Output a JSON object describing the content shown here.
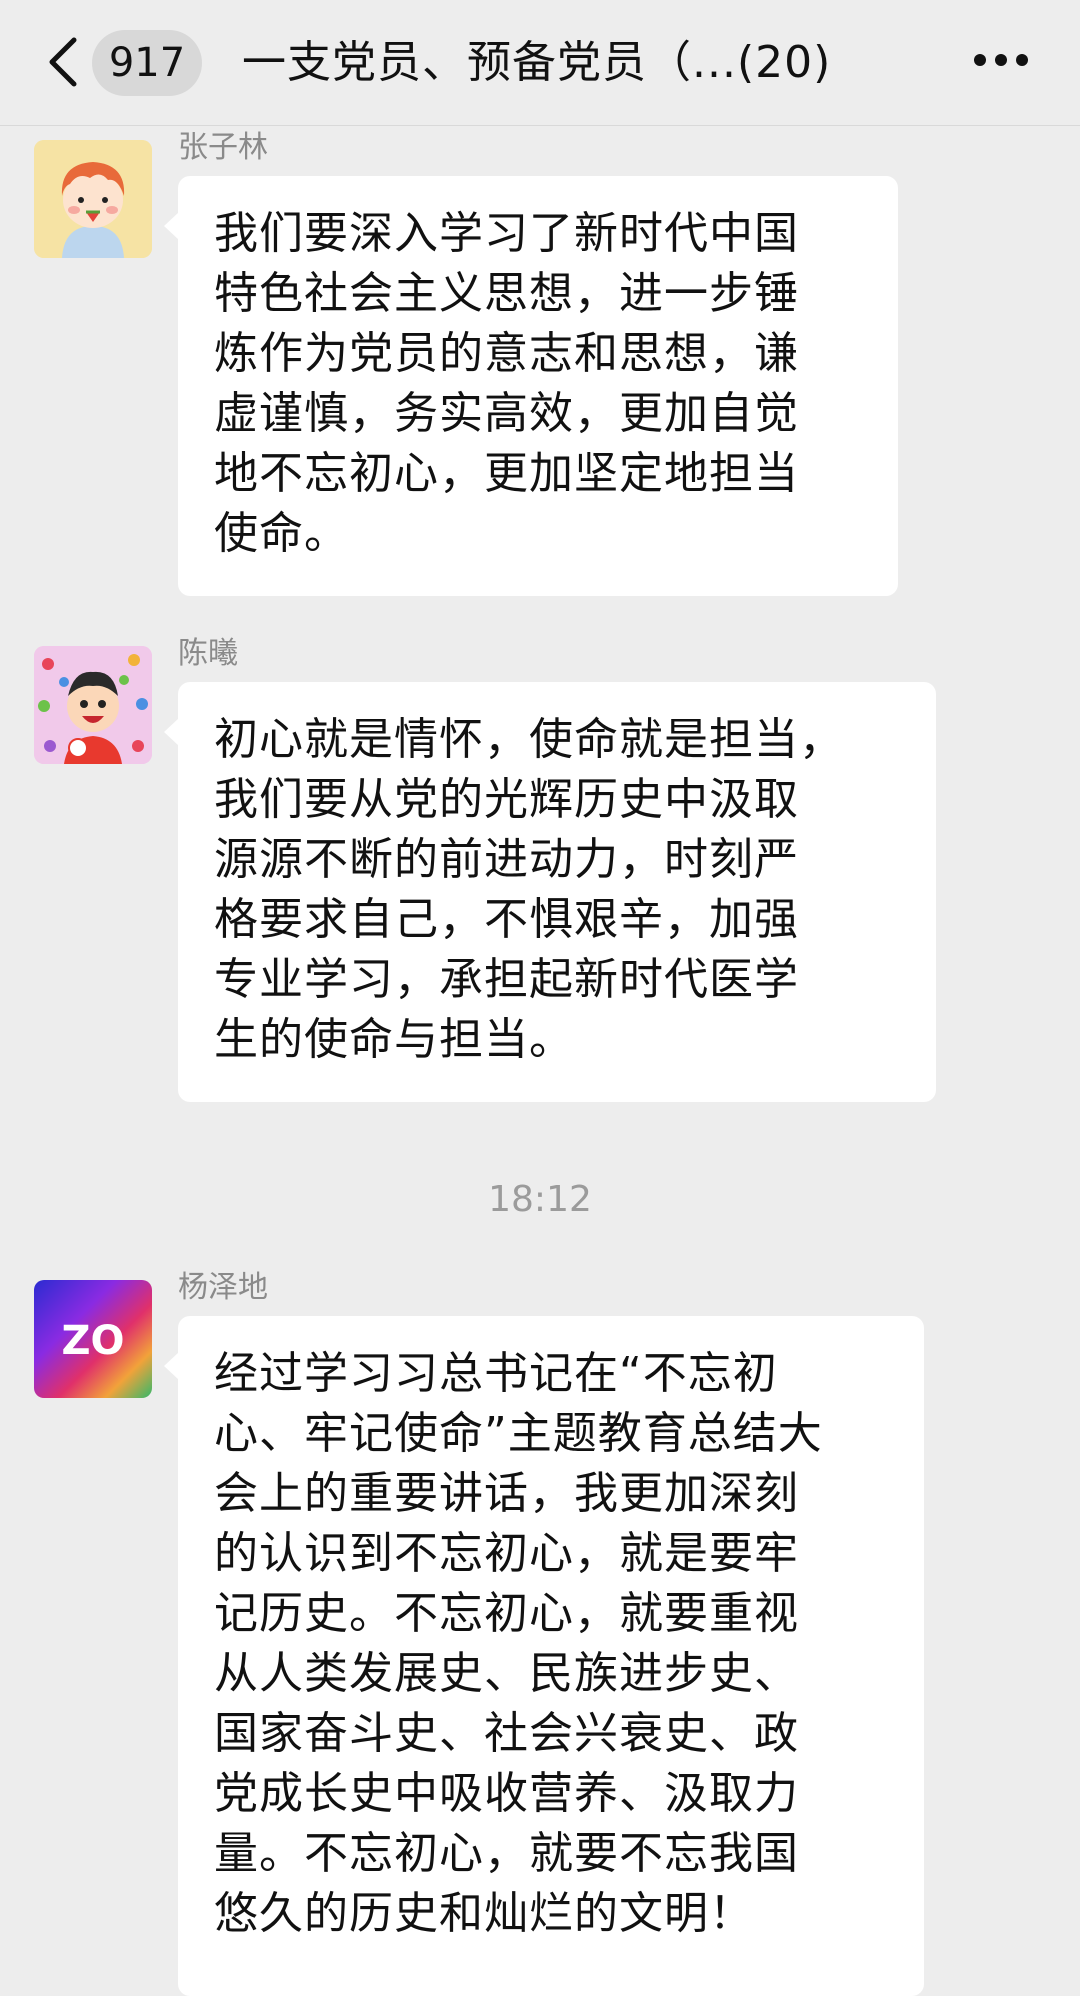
{
  "header": {
    "unread_count": "917",
    "title": "一支党员、预备党员（...(20)",
    "back_icon": "chevron-left-icon",
    "more_icon": "ellipsis-icon"
  },
  "messages": [
    {
      "sender": "张子林",
      "text": "我们要深入学习了新时代中国\n特色社会主义思想，进一步锤\n炼作为党员的意志和思想，谦\n虚谨慎，务实高效，更加自觉\n地不忘初心，更加坚定地担当\n使命。"
    },
    {
      "sender": "陈曦",
      "text": "初心就是情怀，使命就是担当，\n我们要从党的光辉历史中汲取\n源源不断的前进动力，时刻严\n格要求自己，不惧艰辛，加强\n专业学习，承担起新时代医学\n生的使命与担当。"
    },
    {
      "sender": "杨泽地",
      "text": "经过学习习总书记在“不忘初\n心、牢记使命”主题教育总结大\n会上的重要讲话，我更加深刻\n的认识到不忘初心，就是要牢\n记历史。不忘初心，就要重视\n从人类发展史、民族进步史、\n国家奋斗史、社会兴衰史、政\n党成长史中吸收营养、汲取力\n量。不忘初心，就要不忘我国\n悠久的历史和灿烂的文明！"
    }
  ],
  "timestamp": "18:12",
  "avatar_logo_text": "ZO",
  "colors": {
    "background": "#ededed",
    "bubble": "#ffffff",
    "sender_name": "#8a8a8a",
    "timestamp": "#9b9b9b"
  }
}
